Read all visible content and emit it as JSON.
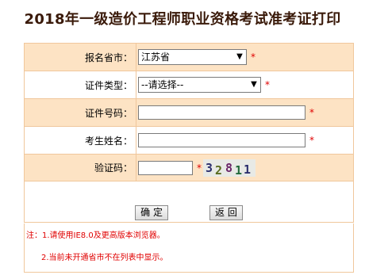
{
  "page": {
    "title": "2018年一级造价工程师职业资格考试准考证打印"
  },
  "form": {
    "province": {
      "label": "报名省市：",
      "value": "江苏省"
    },
    "cert_type": {
      "label": "证件类型：",
      "value": "--请选择--"
    },
    "cert_no": {
      "label": "证件号码：",
      "value": ""
    },
    "name": {
      "label": "考生姓名：",
      "value": ""
    },
    "captcha": {
      "label": "验证码：",
      "value": "",
      "code": [
        "3",
        "2",
        "8",
        "1",
        "1"
      ]
    },
    "required_mark": "*"
  },
  "buttons": {
    "confirm": "确 定",
    "back": "返 回"
  },
  "notes": {
    "line1": "注：1.请使用IE8.0及更高版本浏览器。",
    "line2": "2.当前未开通省市不在列表中显示。"
  },
  "colors": {
    "row_bg": "#fde3c4",
    "border": "#f0c79c",
    "required": "#e00000",
    "title": "#3a1a0a"
  }
}
